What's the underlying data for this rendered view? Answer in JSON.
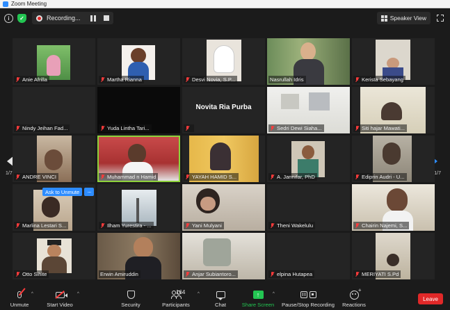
{
  "window": {
    "title": "Zoom Meeting"
  },
  "topbar": {
    "recording_label": "Recording...",
    "view_button": "Speaker View"
  },
  "gallery": {
    "page_left": "1/7",
    "page_right": "1/7",
    "ask_unmute": "Ask to Unmute",
    "ask_more": "···",
    "participants": [
      "Anie Afrilla",
      "Martha Rianna",
      "Desvi Novia, S.P...",
      "Nasrullah Idris",
      "Kerista Sebayang",
      "Nindy Jeihan Fad...",
      "Yuda Lintha Tari...",
      "",
      "Sedri Dewi Siaha...",
      "Siti hajar Mawati...",
      "ANDRE VINCI",
      "Muhammad n Hamid",
      "YAYAH HAMID S...",
      "A. Jannifar, PhD",
      "Ediprin Audri - U...",
      "Marlina Lestari S...",
      "Ilham Yurestira - ...",
      "Yani Mulyani",
      "Theni Wakelulu",
      "Chairin Najemi, S...",
      "Otto Sihite",
      "Erwin Amiruddin",
      "Anjar Subiantoro...",
      "elpina Hutapea",
      "MERIYATI S.Pd"
    ],
    "center_name": "Novita Ria Purba"
  },
  "toolbar": {
    "unmute": "Unmute",
    "start_video": "Start Video",
    "security": "Security",
    "participants": "Participants",
    "participant_count": "164",
    "chat": "Chat",
    "share_screen": "Share Screen",
    "pause_stop": "Pause/Stop Recording",
    "reactions": "Reactions",
    "leave": "Leave"
  },
  "colors": {
    "accent": "#2d8cff",
    "share_green": "#23c552",
    "leave_red": "#e02828",
    "active_speaker": "#8ed23b"
  }
}
